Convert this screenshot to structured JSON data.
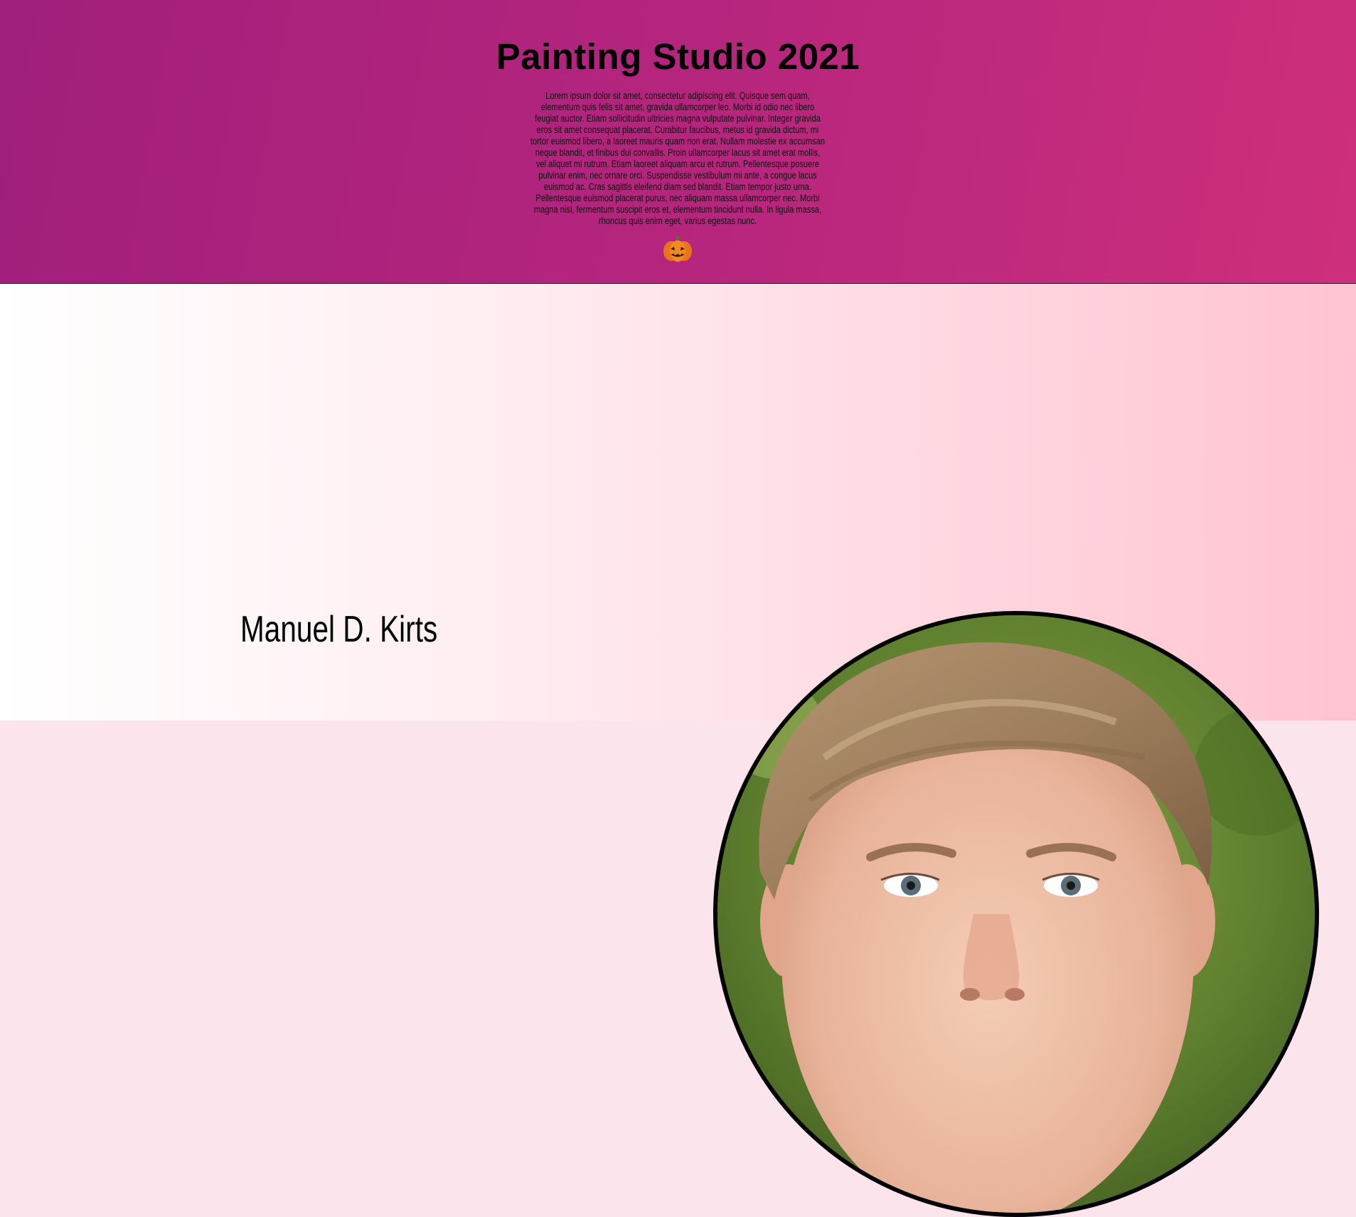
{
  "header": {
    "title": "Painting Studio 2021",
    "intro": "Lorem ipsum dolor sit amet, consectetur adipiscing elit. Quisque sem quam, elementum quis felis sit amet, gravida ullamcorper leo. Morbi id odio nec libero feugiat auctor. Etiam sollicitudin ultricies magna vulputate pulvinar. Integer gravida eros sit amet consequat placerat. Curabitur faucibus, metus id gravida dictum, mi tortor euismod libero, a laoreet mauris quam non erat. Nullam molestie ex accumsan neque blandit, et finibus dui convallis. Proin ullamcorper lacus sit amet erat mollis, vel aliquet mi rutrum. Etiam laoreet aliquam arcu et rutrum. Pellentesque posuere pulvinar enim, nec ornare orci. Suspendisse vestibulum mi ante, a congue lacus euismod ac. Cras sagittis eleifend diam sed blandit. Etiam tempor justo urna. Pellentesque euismod placerat purus, nec aliquam massa ullamcorper nec. Morbi magna nisl, fermentum suscipit eros et, elementum tincidunt nulla. In ligula massa, rhoncus quis enim eget, varius egestas nunc.",
    "icon": "pumpkin-icon",
    "colors": {
      "gradient_start": "#a01f7c",
      "gradient_end": "#cd2f7c"
    }
  },
  "profile": {
    "name": "Manuel D. Kirts",
    "colors": {
      "gradient_start": "#ffffff",
      "gradient_end": "#ffc3d1",
      "frame": "#000000"
    }
  }
}
